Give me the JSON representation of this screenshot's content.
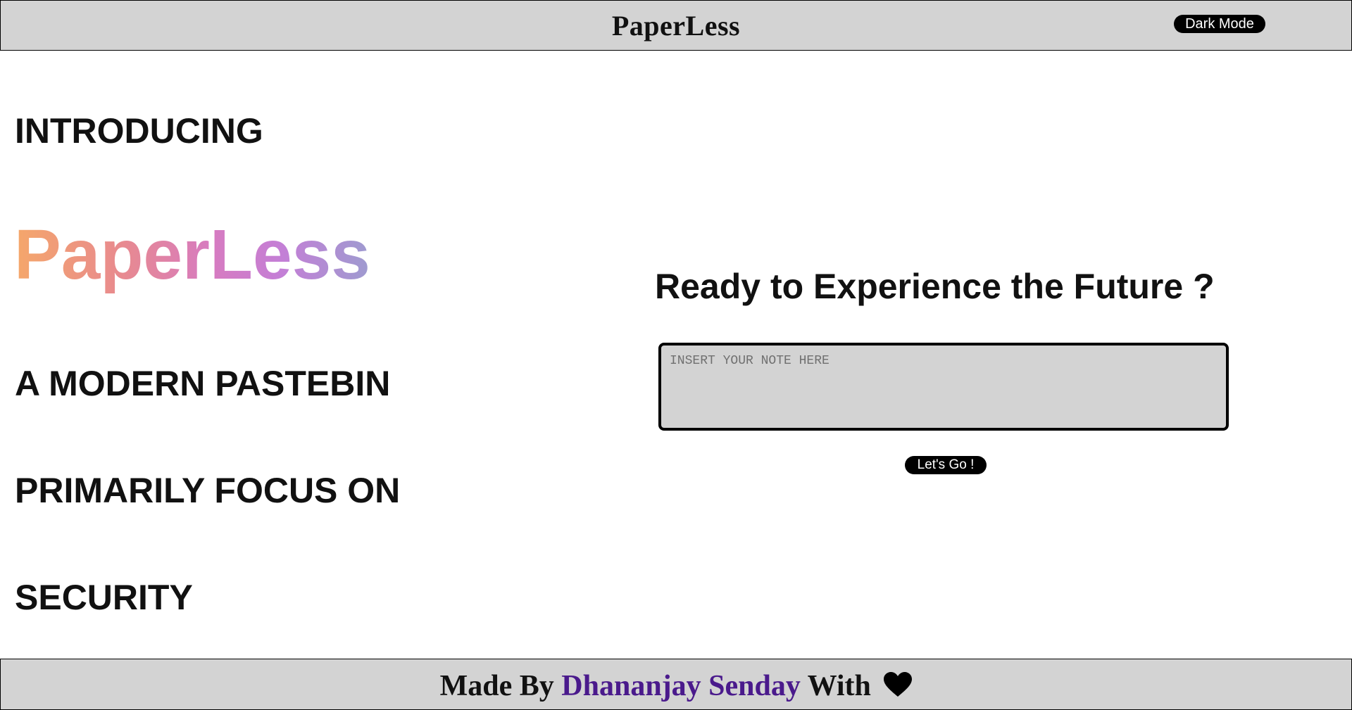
{
  "header": {
    "title": "PaperLess",
    "dark_mode_label": "Dark Mode"
  },
  "intro": {
    "introducing": "INTRODUCING",
    "brand": "PaperLess",
    "tagline": "A MODERN PASTEBIN",
    "focus": "PRIMARILY FOCUS ON",
    "security": "SECURITY"
  },
  "main": {
    "heading": "Ready to Experience the Future ?",
    "note_placeholder": "INSERT YOUR NOTE HERE",
    "note_value": "",
    "go_label": "Let's Go !"
  },
  "footer": {
    "made_by": "Made By",
    "author": "Dhananjay Senday",
    "with": "With",
    "heart_icon": "heart-icon",
    "author_color": "#4a1a8c"
  },
  "colors": {
    "bar_background": "#d3d3d3",
    "button_background": "#000000",
    "brand_gradient": [
      "#f5a76a",
      "#e88a8f",
      "#d77bc0",
      "#c47fd6",
      "#9e9bd0"
    ]
  }
}
